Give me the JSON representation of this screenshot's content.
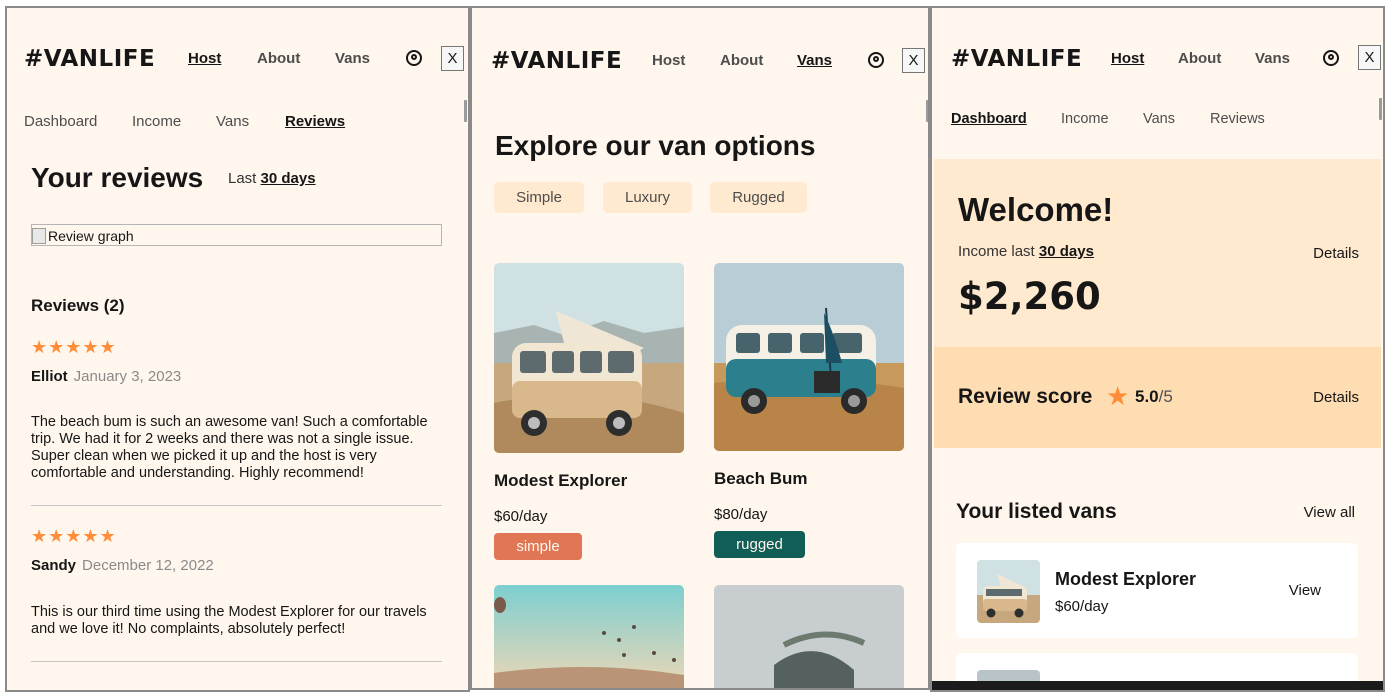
{
  "colors": {
    "page_bg": "#fff7ed",
    "accent_light": "#ffead0",
    "accent_mid": "#ffddb2",
    "star": "#ff8c38",
    "simple_badge": "#e17654",
    "rugged_badge": "#115e59"
  },
  "brand": "#VANLIFE",
  "nav": {
    "host": "Host",
    "about": "About",
    "vans": "Vans",
    "close": "X"
  },
  "host_nav": {
    "dashboard": "Dashboard",
    "income": "Income",
    "vans": "Vans",
    "reviews": "Reviews"
  },
  "reviews_page": {
    "title": "Your reviews",
    "last_prefix": "Last",
    "last_period": "30 days",
    "graph_alt": "Review graph",
    "count_heading": "Reviews (2)",
    "reviews": [
      {
        "stars": "★★★★★",
        "name": "Elliot",
        "date": "January 3, 2023",
        "text": "The beach bum is such an awesome van! Such a comfortable trip. We had it for 2 weeks and there was not a single issue. Super clean when we picked it up and the host is very comfortable and understanding. Highly recommend!"
      },
      {
        "stars": "★★★★★",
        "name": "Sandy",
        "date": "December 12, 2022",
        "text": "This is our third time using the Modest Explorer for our travels and we love it! No complaints, absolutely perfect!"
      }
    ]
  },
  "vans_page": {
    "title": "Explore our van options",
    "filters": [
      "Simple",
      "Luxury",
      "Rugged"
    ],
    "vans": [
      {
        "name": "Modest Explorer",
        "price": "$60/day",
        "type": "simple"
      },
      {
        "name": "Beach Bum",
        "price": "$80/day",
        "type": "rugged"
      }
    ]
  },
  "dashboard_page": {
    "welcome": "Welcome!",
    "income_prefix": "Income last",
    "income_period": "30 days",
    "details": "Details",
    "income_amount": "$2,260",
    "review_score_label": "Review score",
    "score": "5.0",
    "score_suffix": "/5",
    "listed_title": "Your listed vans",
    "view_all": "View all",
    "listed_vans": [
      {
        "name": "Modest Explorer",
        "price": "$60/day",
        "action": "View"
      }
    ]
  }
}
